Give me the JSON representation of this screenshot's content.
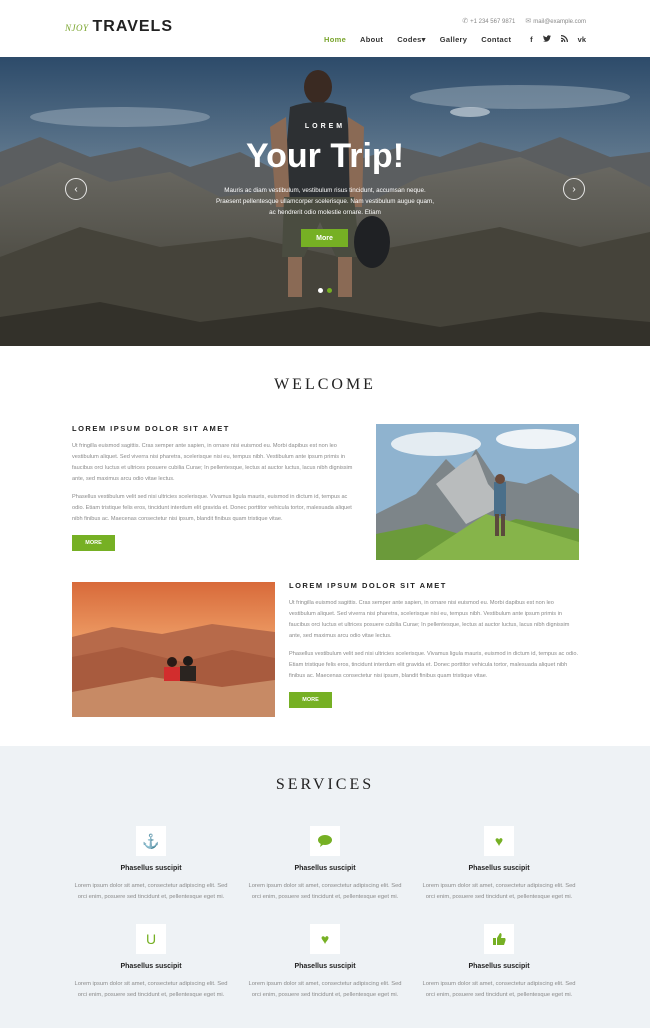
{
  "header": {
    "logo_small": "NJOY",
    "logo_main": "TRAVELS",
    "phone": "+1 234 567 9871",
    "email": "mail@example.com",
    "nav": [
      {
        "label": "Home",
        "active": true
      },
      {
        "label": "About",
        "active": false
      },
      {
        "label": "Codes▾",
        "active": false
      },
      {
        "label": "Gallery",
        "active": false
      },
      {
        "label": "Contact",
        "active": false
      }
    ],
    "social": [
      "f",
      "t",
      "rss",
      "vk"
    ],
    "social_glyphs": [
      "f",
      "🐦",
      "⧈",
      "vk"
    ]
  },
  "hero": {
    "kicker": "LOREM",
    "title": "Your Trip!",
    "text": "Mauris ac diam vestibulum, vestibulum risus tincidunt, accumsan neque. Praesent pellentesque ullamcorper scelerisque. Nam vestibulum augue quam, ac hendrerit odio molestie ornare. Etiam",
    "button": "More",
    "prev_glyph": "‹",
    "next_glyph": "›",
    "slide_count": 2,
    "active_slide": 2
  },
  "welcome": {
    "title": "WELCOME",
    "blocks": [
      {
        "heading": "LOREM IPSUM DOLOR SIT AMET",
        "p1": "Ut fringilla euismod sagittis. Cras semper ante sapien, in ornare nisi euismod eu. Morbi dapibus est non leo vestibulum aliquet. Sed viverra nisi pharetra, scelerisque nisi eu, tempus nibh. Vestibulum ante ipsum primis in faucibus orci luctus et ultrices posuere cubilia Curae; In pellentesque, lectus at auctor luctus, lacus nibh dignissim ante, sed maximus arcu odio vitae lectus.",
        "p2": "Phasellus vestibulum velit sed nisi ultricies scelerisque. Vivamus ligula mauris, euismod in dictum id, tempus ac odio. Etiam tristique felis eros, tincidunt interdum elit gravida et. Donec porttitor vehicula tortor, malesuada aliquet nibh finibus ac. Maecenas consectetur nisi ipsum, blandit finibus quam tristique vitae.",
        "button": "MORE"
      },
      {
        "heading": "LOREM IPSUM DOLOR SIT AMET",
        "p1": "Ut fringilla euismod sagittis. Cras semper ante sapien, in ornare nisi euismod eu. Morbi dapibus est non leo vestibulum aliquet. Sed viverra nisi pharetra, scelerisque nisi eu, tempus nibh. Vestibulum ante ipsum primis in faucibus orci luctus et ultrices posuere cubilia Curae; In pellentesque, lectus at auctor luctus, lacus nibh dignissim ante, sed maximus arcu odio vitae lectus.",
        "p2": "Phasellus vestibulum velit sed nisi ultricies scelerisque. Vivamus ligula mauris, euismod in dictum id, tempus ac odio. Etiam tristique felis eros, tincidunt interdum elit gravida et. Donec porttitor vehicula tortor, malesuada aliquet nibh finibus ac. Maecenas consectetur nisi ipsum, blandit finibus quam tristique vitae.",
        "button": "MORE"
      }
    ]
  },
  "services": {
    "title": "SERVICES",
    "items": [
      {
        "icon": "anchor-icon",
        "glyph": "⚓",
        "title": "Phasellus suscipit",
        "text": "Lorem ipsum dolor sit amet, consectetur adipiscing elit. Sed orci enim, posuere sed tincidunt et, pellentesque eget mi."
      },
      {
        "icon": "comment-icon",
        "glyph": "💬",
        "title": "Phasellus suscipit",
        "text": "Lorem ipsum dolor sit amet, consectetur adipiscing elit. Sed orci enim, posuere sed tincidunt et, pellentesque eget mi."
      },
      {
        "icon": "heartbeat-icon",
        "glyph": "♥",
        "title": "Phasellus suscipit",
        "text": "Lorem ipsum dolor sit amet, consectetur adipiscing elit. Sed orci enim, posuere sed tincidunt et, pellentesque eget mi."
      },
      {
        "icon": "magnet-icon",
        "glyph": "U",
        "title": "Phasellus suscipit",
        "text": "Lorem ipsum dolor sit amet, consectetur adipiscing elit. Sed orci enim, posuere sed tincidunt et, pellentesque eget mi."
      },
      {
        "icon": "heartbeat-icon",
        "glyph": "♥",
        "title": "Phasellus suscipit",
        "text": "Lorem ipsum dolor sit amet, consectetur adipiscing elit. Sed orci enim, posuere sed tincidunt et, pellentesque eget mi."
      },
      {
        "icon": "thumbs-up-icon",
        "glyph": "👍",
        "title": "Phasellus suscipit",
        "text": "Lorem ipsum dolor sit amet, consectetur adipiscing elit. Sed orci enim, posuere sed tincidunt et, pellentesque eget mi."
      }
    ]
  },
  "colors": {
    "accent": "#76b024",
    "services_bg": "#eef2f5"
  }
}
